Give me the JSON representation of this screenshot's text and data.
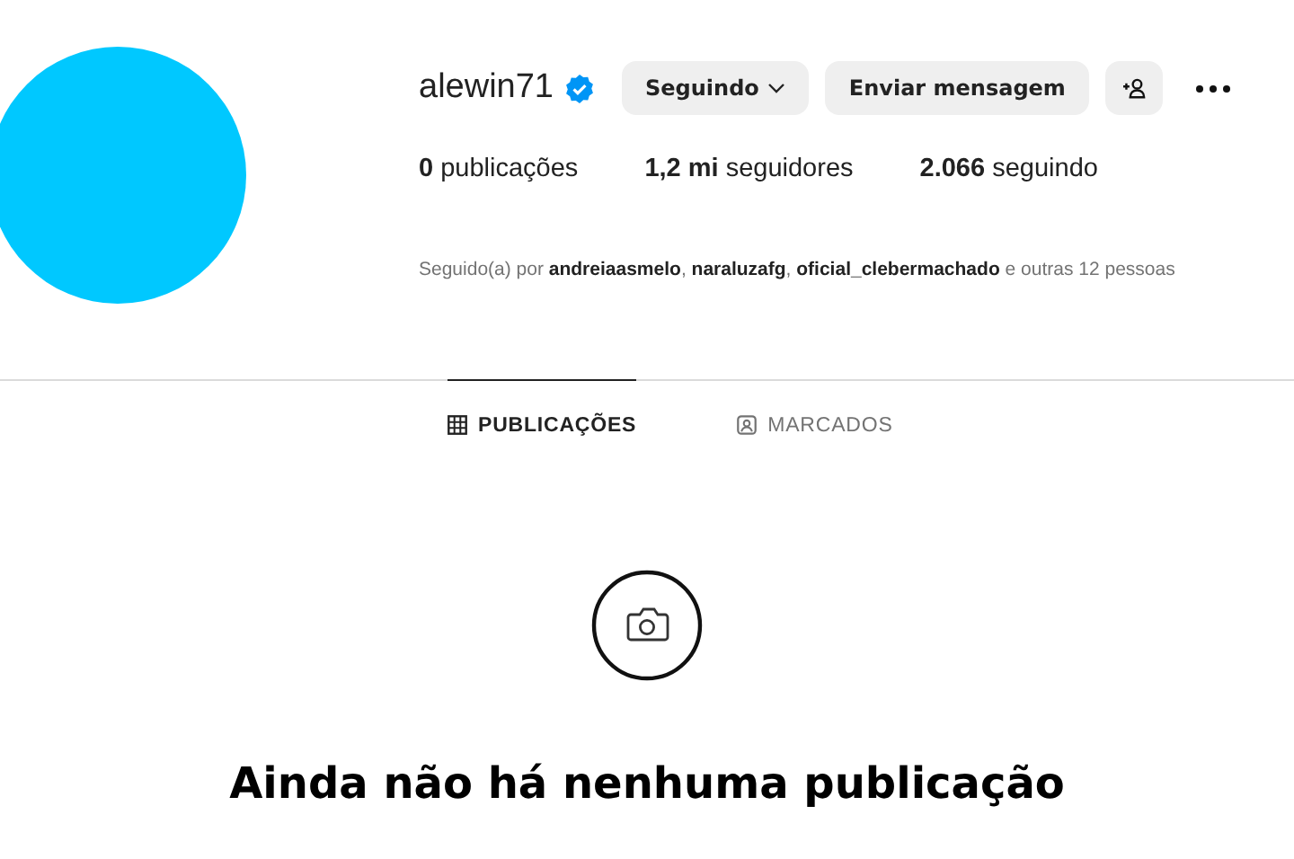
{
  "profile": {
    "username": "alewin71",
    "verified": true,
    "buttons": [
      {
        "kind": "dropdown",
        "label": "Seguindo"
      },
      {
        "kind": "text",
        "label": "Enviar mensagem"
      },
      {
        "kind": "add-person"
      },
      {
        "kind": "more"
      }
    ],
    "stats": [
      "**0** publicações",
      "**1,2 mi** seguidores",
      "**2.066** seguindo"
    ],
    "followed_by": "Seguido(a) por **andreiaasmelo**, **naraluzafg**, **oficial_clebermachado** e outras 12 pessoas"
  },
  "tabs": [
    {
      "kind": "grid",
      "label": "PUBLICAÇÕES",
      "selected": true
    },
    {
      "kind": "tagged",
      "label": "MARCADOS",
      "selected": false
    }
  ],
  "empty_state": {
    "title": "Ainda não há nenhuma publicação"
  }
}
